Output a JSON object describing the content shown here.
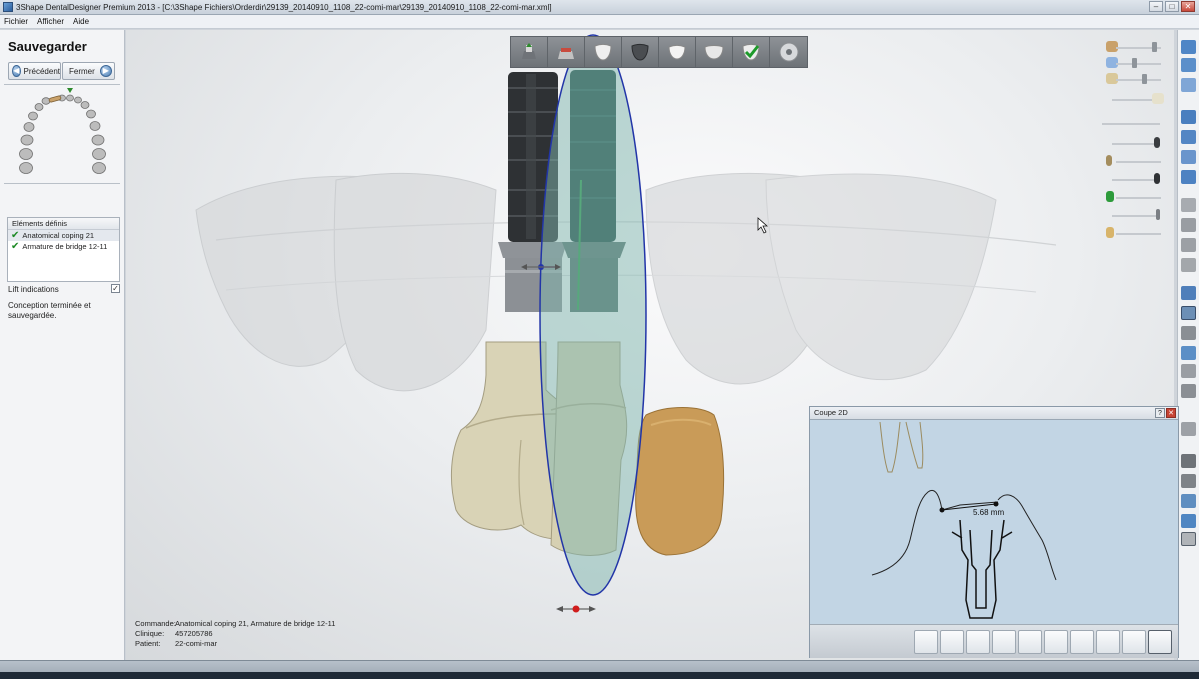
{
  "window": {
    "title": "3Shape DentalDesigner Premium 2013 - [C:\\3Shape Fichiers\\Orderdir\\29139_20140910_1108_22-comi-mar\\29139_20140910_1108_22-comi-mar.xml]",
    "controls": [
      "minimize",
      "maximize",
      "close"
    ]
  },
  "menu": [
    "Fichier",
    "Afficher",
    "Aide"
  ],
  "left_panel": {
    "title": "Sauvegarder",
    "prev_label": "Précédent",
    "close_label": "Fermer",
    "defined_header": "Eléments définis",
    "defined_items": [
      "Anatomical coping 21",
      "Armature de bridge 12-11"
    ],
    "lift_label": "Lift indications",
    "lift_checked": true,
    "status": "Conception terminée et sauvegardée."
  },
  "toolbar": {
    "steps": [
      "implant-step-icon",
      "abutment-step-icon",
      "tooth-step-icon",
      "coping-step-icon",
      "tooth-step-icon-2",
      "bridge-step-icon",
      "checked-tooth-icon",
      "save-disc-icon"
    ]
  },
  "info": {
    "commande_label": "Commande:",
    "commande": "Anatomical coping 21, Armature de bridge 12-11",
    "clinique_label": "Clinique:",
    "clinique": "457205786",
    "patient_label": "Patient:",
    "patient": "22-comi-mar"
  },
  "coupe": {
    "title": "Coupe 2D",
    "measurement": "5.68 mm"
  },
  "colors": {
    "implant_dark": "#2e3134",
    "abutment_grey": "#8f9398",
    "tooth": "#d9d3b6",
    "crown_gold": "#c99b58",
    "plane_teal": "#7fb5ad",
    "plane_outline": "#2235a8",
    "coupe_bg": "#c2d5e4"
  }
}
